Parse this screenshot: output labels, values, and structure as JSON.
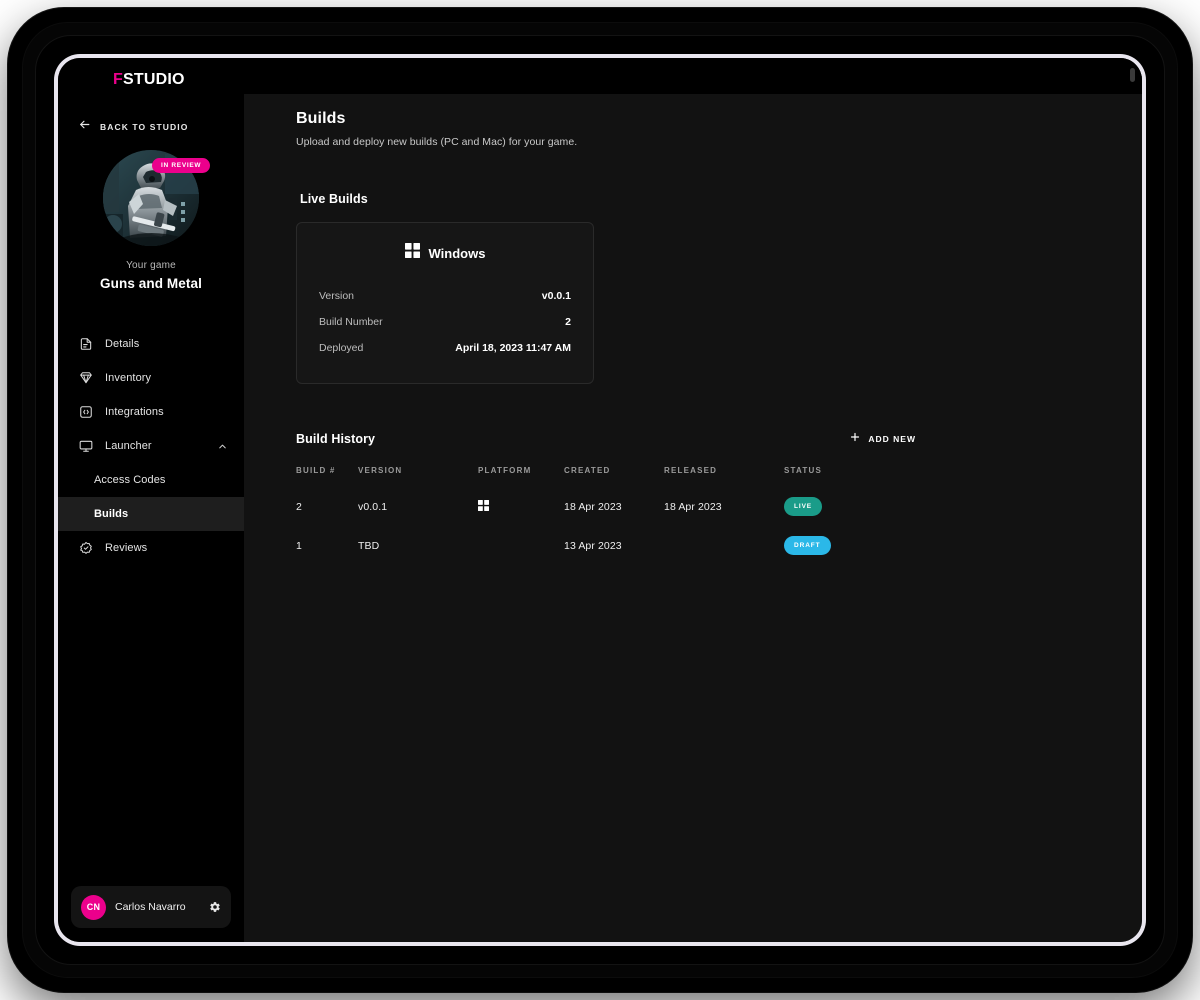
{
  "brand": {
    "accent_letter": "F",
    "rest": "STUDIO",
    "accent_color": "#ec008c"
  },
  "sidebar": {
    "back_link": {
      "label": "BACK TO STUDIO",
      "icon": "arrow-left-icon"
    },
    "game": {
      "badge": "IN REVIEW",
      "caption": "Your game",
      "title": "Guns and Metal"
    },
    "nav": [
      {
        "label": "Details",
        "icon": "document-icon",
        "active": false
      },
      {
        "label": "Inventory",
        "icon": "gem-icon",
        "active": false
      },
      {
        "label": "Integrations",
        "icon": "code-brackets-icon",
        "active": false
      },
      {
        "label": "Launcher",
        "icon": "monitor-icon",
        "active": false,
        "expanded": true
      },
      {
        "label": "Access Codes",
        "icon": "",
        "active": false,
        "sub": true
      },
      {
        "label": "Builds",
        "icon": "",
        "active": true,
        "sub": true
      },
      {
        "label": "Reviews",
        "icon": "check-badge-icon",
        "active": false
      }
    ],
    "user": {
      "initials": "CN",
      "name": "Carlos Navarro",
      "settings_icon": "gear-icon"
    }
  },
  "main": {
    "title": "Builds",
    "subtitle": "Upload and deploy new builds (PC and Mac) for your game.",
    "live_builds": {
      "section_title": "Live Builds",
      "card": {
        "platform": "Windows",
        "platform_icon": "windows-icon",
        "rows": [
          {
            "key": "Version",
            "value": "v0.0.1"
          },
          {
            "key": "Build Number",
            "value": "2"
          },
          {
            "key": "Deployed",
            "value": "April 18, 2023 11:47 AM"
          }
        ]
      }
    },
    "build_history": {
      "section_title": "Build History",
      "add_new_label": "ADD NEW",
      "add_new_icon": "plus-icon",
      "columns": [
        "BUILD #",
        "VERSION",
        "PLATFORM",
        "CREATED",
        "RELEASED",
        "STATUS"
      ],
      "rows": [
        {
          "build": "2",
          "version": "v0.0.1",
          "platform_icon": "windows-icon",
          "created": "18 Apr 2023",
          "released": "18 Apr 2023",
          "status": "LIVE",
          "status_kind": "live"
        },
        {
          "build": "1",
          "version": "TBD",
          "platform_icon": "",
          "created": "13 Apr 2023",
          "released": "",
          "status": "DRAFT",
          "status_kind": "draft"
        }
      ]
    }
  },
  "colors": {
    "accent_pink": "#ec008c",
    "status_live": "#1a9c89",
    "status_draft": "#2bb8e8",
    "sidebar_bg": "#000000",
    "main_bg": "#121212"
  }
}
